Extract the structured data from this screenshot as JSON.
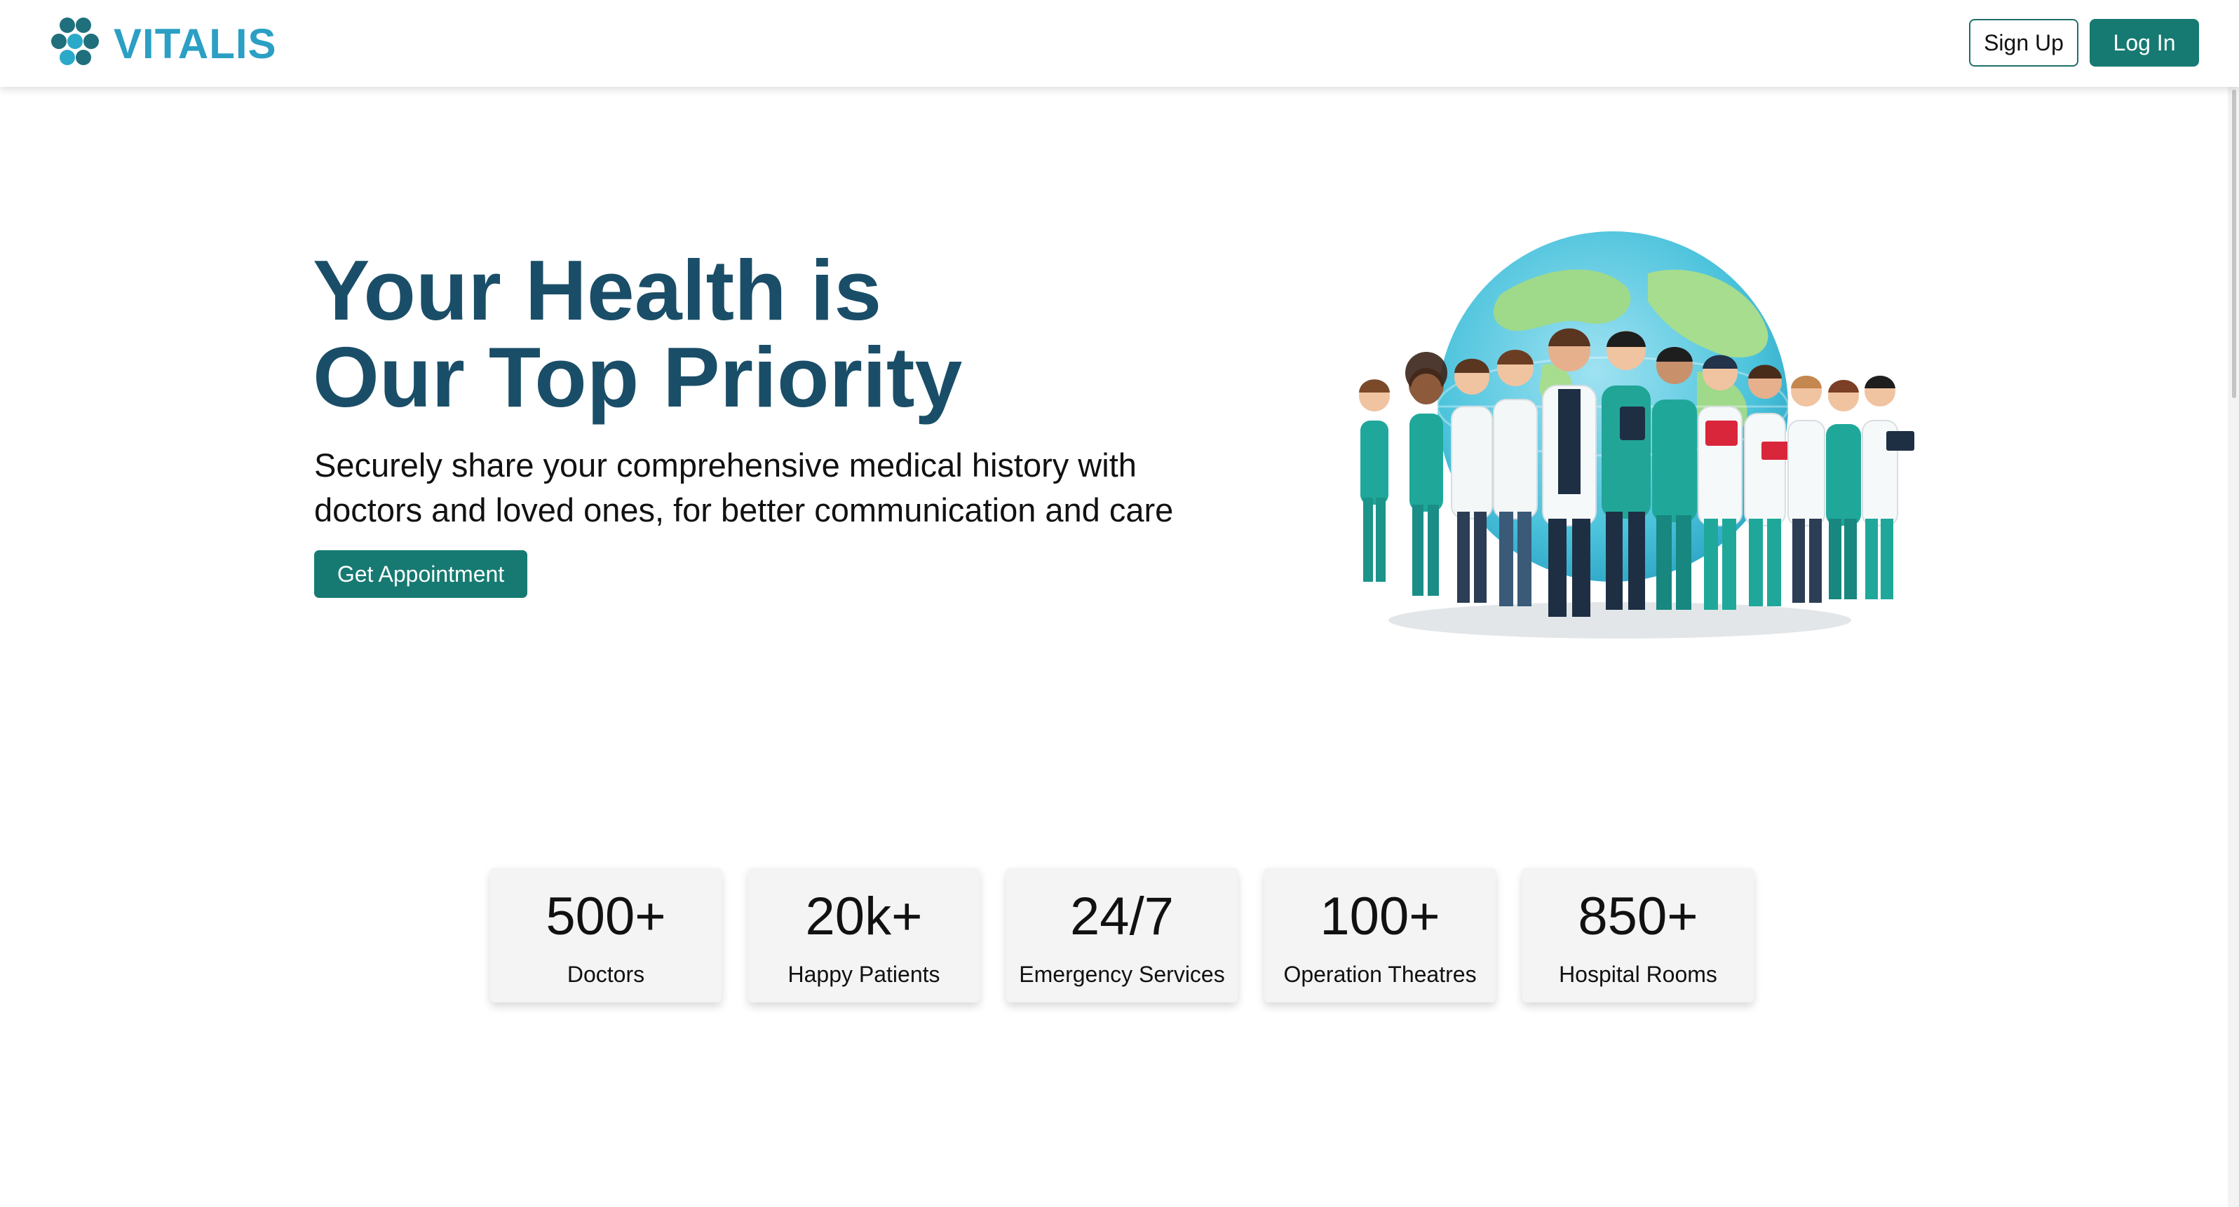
{
  "header": {
    "brand": "VITALIS",
    "signup_label": "Sign Up",
    "login_label": "Log In"
  },
  "hero": {
    "title_line1": "Your Health is",
    "title_line2": "Our Top Priority",
    "subtitle": "Securely share your comprehensive medical history with doctors and loved ones, for better communication and care",
    "cta_label": "Get Appointment",
    "illustration": "medical-team-with-globe-illustration"
  },
  "stats": [
    {
      "value": "500+",
      "label": "Doctors"
    },
    {
      "value": "20k+",
      "label": "Happy Patients"
    },
    {
      "value": "24/7",
      "label": "Emergency Services"
    },
    {
      "value": "100+",
      "label": "Operation Theatres"
    },
    {
      "value": "850+",
      "label": "Hospital Rooms"
    }
  ],
  "colors": {
    "brand_text": "#2b9fc4",
    "primary": "#167a72",
    "heading": "#1a4e68",
    "card_bg": "#f4f4f4"
  },
  "icons": {
    "logo": "hexagon-cluster-logo-icon"
  }
}
